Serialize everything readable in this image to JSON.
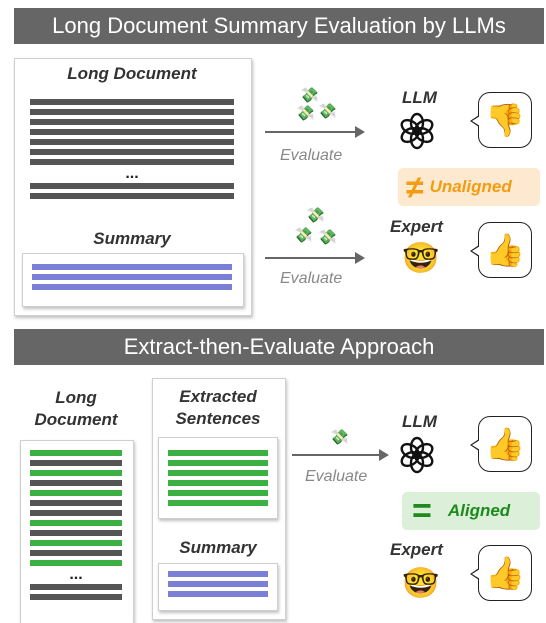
{
  "top": {
    "title": "Long Document Summary Evaluation by LLMs",
    "long_document_label": "Long Document",
    "summary_label": "Summary",
    "ellipsis": "...",
    "evaluate_label_1": "Evaluate",
    "evaluate_label_2": "Evaluate",
    "llm_label": "LLM",
    "expert_label": "Expert",
    "unaligned_symbol": "≠",
    "unaligned_label": "Unaligned"
  },
  "bottom": {
    "title": "Extract-then-Evaluate Approach",
    "long_document_label_line1": "Long",
    "long_document_label_line2": "Document",
    "extracted_label_line1": "Extracted",
    "extracted_label_line2": "Sentences",
    "summary_label": "Summary",
    "ellipsis": "...",
    "evaluate_label": "Evaluate",
    "llm_label": "LLM",
    "expert_label": "Expert",
    "aligned_symbol": "=",
    "aligned_label": "Aligned"
  },
  "icons": {
    "money": "💸",
    "thumbs_down": "👎",
    "thumbs_up": "👍",
    "nerd_face": "🤓"
  },
  "colors": {
    "banner": "#666666",
    "doc_line": "#555555",
    "summary_line": "#7b7fd6",
    "extracted_line": "#3cb043",
    "unaligned_bg": "#fde9cf",
    "unaligned_text": "#f39c12",
    "aligned_bg": "#dcefd9",
    "aligned_text": "#1e8a1e"
  }
}
